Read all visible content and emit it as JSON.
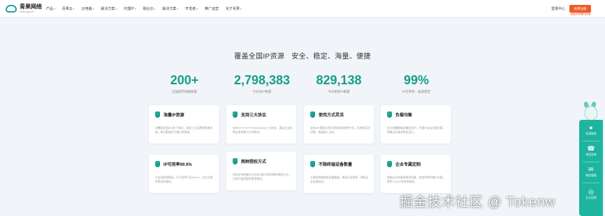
{
  "header": {
    "logo_name": "青果网络",
    "logo_sub": "www.qg.net",
    "nav": [
      "产品",
      "青果云",
      "云电脑",
      "解决方案",
      "代理IP",
      "融合云",
      "解决方案",
      "开发者",
      "推广运营",
      "关于青果"
    ],
    "user_center": "登录中心",
    "register_label": "免费注册",
    "register_badge": "新客专享限时特惠"
  },
  "main": {
    "headline": "覆盖全国IP资源　安全、稳定、海量、便捷",
    "stats": [
      {
        "value": "200+",
        "label": "全国城市线路数量"
      },
      {
        "value": "2,798,383",
        "label": "今日总IP数量"
      },
      {
        "value": "829,138",
        "label": "今日更新IP数量"
      },
      {
        "value": "99%",
        "label": "IP可用率，极速稳定"
      }
    ],
    "features": [
      {
        "title": "海量IP资源",
        "desc": "IP覆盖全国200多个城市，采用三大运营商宽带资源，每日更新百万级IP资源池。"
      },
      {
        "title": "支持三大协议",
        "desc": "支持HTTP/HTTPS/SOCKS5三大协议，满足企业多种应用场景与开发需求。"
      },
      {
        "title": "使用方式灵活",
        "desc": "支持API提取与账号密码授权多种方式，可按需灵活切换，快速接入业务。"
      },
      {
        "title": "负载均衡",
        "desc": "在大规模数据采集应用中，代理IP自动分配切换，保障业务请求稳定运行。"
      },
      {
        "title": "IP可用率99.9%",
        "desc": "IP自动检测筛选，IP可用率可达99.9%，为企业提供稳定的服务。"
      },
      {
        "title": "两种授权方式",
        "desc": "同时支持终端IP白名单与账号密码两种授权方式，为用户使用提供更多便利。"
      },
      {
        "title": "不限终端设备数量",
        "desc": "不限制终端使用设备数量，提高业务效率，降低企业运营成本。"
      },
      {
        "title": "企业专属定制",
        "desc": "根据企业的具体需求场景，定制专属代理IP方案，提供7×24小时技术服务。"
      }
    ]
  },
  "sidebar": {
    "items": [
      {
        "icon": "bell",
        "glyph": "🔔",
        "label": "在线咨询"
      },
      {
        "icon": "phone",
        "glyph": "☎",
        "label": "电话咨询"
      },
      {
        "icon": "chat",
        "glyph": "✉",
        "label": "微信客服"
      },
      {
        "icon": "service",
        "glyph": "◎",
        "label": "企业定制"
      }
    ]
  },
  "watermark": "掘金技术社区 @ Tokenw",
  "colors": {
    "accent": "#15a08c",
    "cta": "#f05a28",
    "panel": "#1eb5a0"
  }
}
